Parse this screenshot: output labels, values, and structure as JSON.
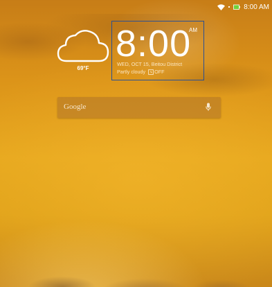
{
  "status_bar": {
    "time": "8:00 AM",
    "icons": [
      "wifi-icon",
      "battery-icon"
    ]
  },
  "weather": {
    "icon": "cloud-icon",
    "temperature": "69°F"
  },
  "clock": {
    "time": "8:00",
    "ampm": "AM",
    "date_location": "WED, OCT 15, Beitou District",
    "condition": "Partly cloudy",
    "alarm_icon": "alarm-icon",
    "alarm_status": "OFF"
  },
  "search": {
    "label": "Google",
    "icon": "mic-icon"
  },
  "colors": {
    "highlight_border": "#2a4f93"
  }
}
